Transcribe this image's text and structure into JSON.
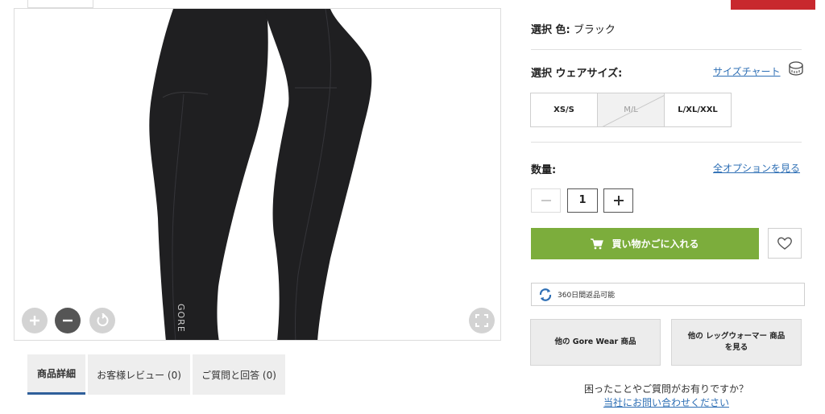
{
  "gallery": {
    "brand_mark": "GORE"
  },
  "tabs": [
    {
      "label": "商品詳細"
    },
    {
      "label": "お客様レビュー (0)"
    },
    {
      "label": "ご質問と回答 (0)"
    }
  ],
  "product": {
    "color_prefix": "選択 色:",
    "color_value": "ブラック",
    "size_label": "選択 ウェアサイズ:",
    "size_chart_link": "サイズチャート",
    "sizes": [
      {
        "label": "XS/S",
        "available": true
      },
      {
        "label": "M/L",
        "available": false
      },
      {
        "label": "L/XL/XXL",
        "available": true
      }
    ],
    "quantity_label": "数量:",
    "all_options_link": "全オプションを見る",
    "quantity_value": "1",
    "add_to_cart_label": "買い物かごに入れる",
    "returns_text": "360日間返品可能",
    "more_brand_button": "他の Gore Wear 商品",
    "more_category_button_line1": "他の レッグウォーマー 商品",
    "more_category_button_line2": "を見る",
    "help_question": "困ったことやご質問がお有りですか？",
    "help_link": "当社にお問い合わせください"
  },
  "colors": {
    "accent_green": "#7cad3c",
    "link_blue": "#2e6fb5",
    "brand_red": "#c8282e"
  },
  "icons": [
    "zoom-in-icon",
    "zoom-out-icon",
    "rotate-icon",
    "fullscreen-icon",
    "measuring-tape-icon",
    "minus-icon",
    "plus-icon",
    "cart-icon",
    "heart-icon",
    "returns-icon"
  ]
}
